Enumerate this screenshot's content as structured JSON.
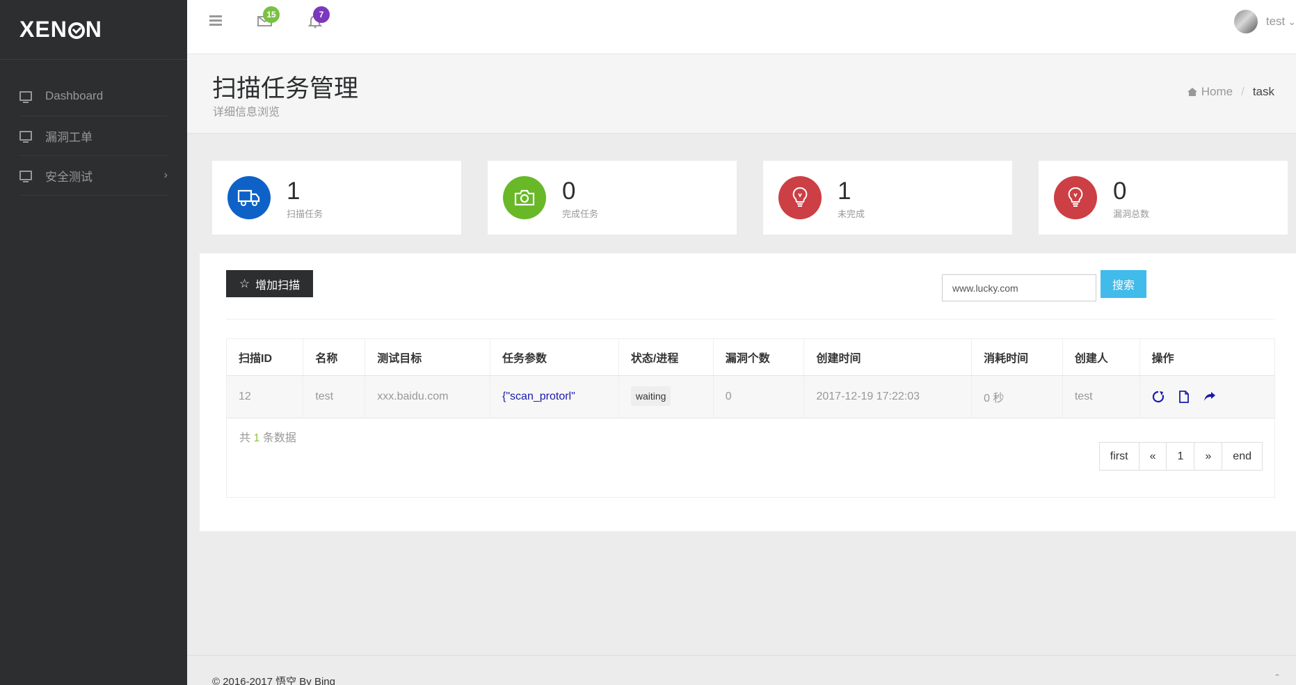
{
  "app": {
    "logo": "XENON"
  },
  "sidebar": {
    "items": [
      {
        "label": "Dashboard"
      },
      {
        "label": "漏洞工单"
      },
      {
        "label": "安全测试",
        "chevron": "›"
      }
    ]
  },
  "topbar": {
    "mail_badge": "15",
    "bell_badge": "7",
    "user_name": "test",
    "colors": {
      "mail_badge": "#7ac143",
      "bell_badge": "#7c38bc"
    }
  },
  "page": {
    "title": "扫描任务管理",
    "description": "详细信息浏览",
    "breadcrumb": {
      "home": "Home",
      "separator": "/",
      "current": "task"
    }
  },
  "stats": [
    {
      "value": "1",
      "label": "扫描任务",
      "icon": "truck-icon",
      "color": "#0e62c7"
    },
    {
      "value": "0",
      "label": "完成任务",
      "icon": "camera-icon",
      "color": "#68b828"
    },
    {
      "value": "1",
      "label": "未完成",
      "icon": "lightbulb-icon",
      "color": "#cc3f44"
    },
    {
      "value": "0",
      "label": "漏洞总数",
      "icon": "lightbulb-icon",
      "color": "#cc3f44"
    }
  ],
  "toolbar": {
    "add_label": "增加扫描",
    "search_value": "www.lucky.com",
    "search_label": "搜索"
  },
  "table": {
    "headers": [
      "扫描ID",
      "名称",
      "测试目标",
      "任务参数",
      "状态/进程",
      "漏洞个数",
      "创建时间",
      "消耗时间",
      "创建人",
      "操作"
    ],
    "rows": [
      {
        "id": "12",
        "name": "test",
        "target": "xxx.baidu.com",
        "params": "{\"scan_protorl\"",
        "status": "waiting",
        "vuln_count": "0",
        "created": "2017-12-19 17:22:03",
        "elapsed": "0 秒",
        "creator": "test",
        "ops": [
          "refresh-icon",
          "document-icon",
          "share-icon"
        ]
      }
    ]
  },
  "summary": {
    "prefix": "共",
    "count": "1",
    "suffix": "条数据"
  },
  "pagination": [
    "first",
    "«",
    "1",
    "»",
    "end"
  ],
  "footer": {
    "copyright": "© 2016-2017 悟空 By Bing"
  }
}
